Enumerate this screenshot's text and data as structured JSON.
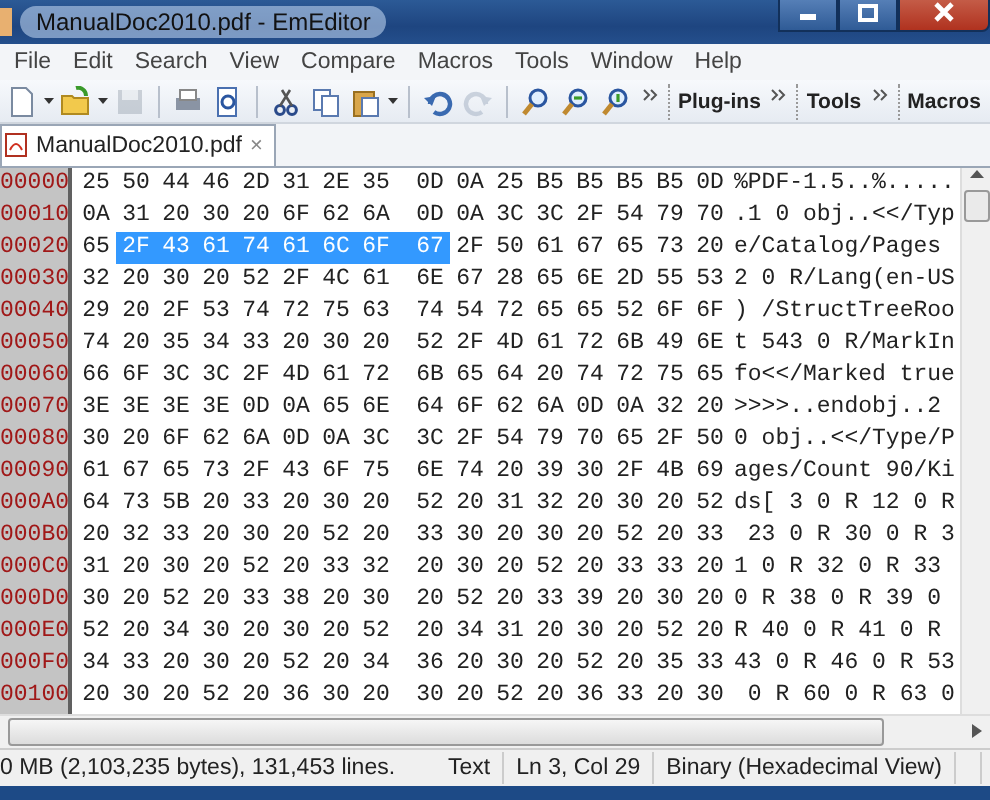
{
  "window": {
    "title": "ManualDoc2010.pdf - EmEditor"
  },
  "menu": [
    "File",
    "Edit",
    "Search",
    "View",
    "Compare",
    "Macros",
    "Tools",
    "Window",
    "Help"
  ],
  "toolbar": {
    "groups": [
      [
        {
          "kind": "new",
          "disabled": false
        },
        {
          "kind": "dropdown",
          "disabled": false
        },
        {
          "kind": "open",
          "disabled": false
        },
        {
          "kind": "dropdown",
          "disabled": false
        },
        {
          "kind": "save",
          "disabled": true
        }
      ],
      [
        {
          "kind": "print",
          "disabled": false
        },
        {
          "kind": "preview",
          "disabled": false
        }
      ],
      [
        {
          "kind": "cut",
          "disabled": false
        },
        {
          "kind": "copy",
          "disabled": false
        },
        {
          "kind": "paste",
          "disabled": false
        },
        {
          "kind": "dropdown",
          "disabled": false
        }
      ],
      [
        {
          "kind": "undo",
          "disabled": false
        },
        {
          "kind": "redo",
          "disabled": true
        }
      ],
      [
        {
          "kind": "find",
          "disabled": false
        },
        {
          "kind": "find-next",
          "disabled": false
        },
        {
          "kind": "find-prev",
          "disabled": false
        }
      ]
    ],
    "bands": [
      "Plug-ins",
      "Tools",
      "Macros"
    ]
  },
  "tabs": [
    {
      "label": "ManualDoc2010.pdf",
      "selected": true,
      "close": "×"
    }
  ],
  "hex_view": {
    "rows": [
      {
        "address": "00000",
        "bytes": [
          {
            "hex": "25",
            "selected": false
          },
          {
            "hex": "50",
            "selected": false
          },
          {
            "hex": "44",
            "selected": false
          },
          {
            "hex": "46",
            "selected": false
          },
          {
            "hex": "2D",
            "selected": false
          },
          {
            "hex": "31",
            "selected": false
          },
          {
            "hex": "2E",
            "selected": false
          },
          {
            "hex": "35",
            "selected": false
          },
          {
            "hex": "0D",
            "selected": false
          },
          {
            "hex": "0A",
            "selected": false
          },
          {
            "hex": "25",
            "selected": false
          },
          {
            "hex": "B5",
            "selected": false
          },
          {
            "hex": "B5",
            "selected": false
          },
          {
            "hex": "B5",
            "selected": false
          },
          {
            "hex": "B5",
            "selected": false
          },
          {
            "hex": "0D",
            "selected": false
          }
        ],
        "text": "%PDF-1.5..%....."
      },
      {
        "address": "00010",
        "bytes": [
          {
            "hex": "0A",
            "selected": false
          },
          {
            "hex": "31",
            "selected": false
          },
          {
            "hex": "20",
            "selected": false
          },
          {
            "hex": "30",
            "selected": false
          },
          {
            "hex": "20",
            "selected": false
          },
          {
            "hex": "6F",
            "selected": false
          },
          {
            "hex": "62",
            "selected": false
          },
          {
            "hex": "6A",
            "selected": false
          },
          {
            "hex": "0D",
            "selected": false
          },
          {
            "hex": "0A",
            "selected": false
          },
          {
            "hex": "3C",
            "selected": false
          },
          {
            "hex": "3C",
            "selected": false
          },
          {
            "hex": "2F",
            "selected": false
          },
          {
            "hex": "54",
            "selected": false
          },
          {
            "hex": "79",
            "selected": false
          },
          {
            "hex": "70",
            "selected": false
          }
        ],
        "text": ".1 0 obj..<</Typ"
      },
      {
        "address": "00020",
        "bytes": [
          {
            "hex": "65",
            "selected": false
          },
          {
            "hex": "2F",
            "selected": true
          },
          {
            "hex": "43",
            "selected": true
          },
          {
            "hex": "61",
            "selected": true
          },
          {
            "hex": "74",
            "selected": true
          },
          {
            "hex": "61",
            "selected": true
          },
          {
            "hex": "6C",
            "selected": true
          },
          {
            "hex": "6F",
            "selected": true
          },
          {
            "hex": "67",
            "selected": true
          },
          {
            "hex": "2F",
            "selected": false
          },
          {
            "hex": "50",
            "selected": false
          },
          {
            "hex": "61",
            "selected": false
          },
          {
            "hex": "67",
            "selected": false
          },
          {
            "hex": "65",
            "selected": false
          },
          {
            "hex": "73",
            "selected": false
          },
          {
            "hex": "20",
            "selected": false
          }
        ],
        "text": "e/Catalog/Pages"
      },
      {
        "address": "00030",
        "bytes": [
          {
            "hex": "32",
            "selected": false
          },
          {
            "hex": "20",
            "selected": false
          },
          {
            "hex": "30",
            "selected": false
          },
          {
            "hex": "20",
            "selected": false
          },
          {
            "hex": "52",
            "selected": false
          },
          {
            "hex": "2F",
            "selected": false
          },
          {
            "hex": "4C",
            "selected": false
          },
          {
            "hex": "61",
            "selected": false
          },
          {
            "hex": "6E",
            "selected": false
          },
          {
            "hex": "67",
            "selected": false
          },
          {
            "hex": "28",
            "selected": false
          },
          {
            "hex": "65",
            "selected": false
          },
          {
            "hex": "6E",
            "selected": false
          },
          {
            "hex": "2D",
            "selected": false
          },
          {
            "hex": "55",
            "selected": false
          },
          {
            "hex": "53",
            "selected": false
          }
        ],
        "text": "2 0 R/Lang(en-US"
      },
      {
        "address": "00040",
        "bytes": [
          {
            "hex": "29",
            "selected": false
          },
          {
            "hex": "20",
            "selected": false
          },
          {
            "hex": "2F",
            "selected": false
          },
          {
            "hex": "53",
            "selected": false
          },
          {
            "hex": "74",
            "selected": false
          },
          {
            "hex": "72",
            "selected": false
          },
          {
            "hex": "75",
            "selected": false
          },
          {
            "hex": "63",
            "selected": false
          },
          {
            "hex": "74",
            "selected": false
          },
          {
            "hex": "54",
            "selected": false
          },
          {
            "hex": "72",
            "selected": false
          },
          {
            "hex": "65",
            "selected": false
          },
          {
            "hex": "65",
            "selected": false
          },
          {
            "hex": "52",
            "selected": false
          },
          {
            "hex": "6F",
            "selected": false
          },
          {
            "hex": "6F",
            "selected": false
          }
        ],
        "text": ") /StructTreeRoo"
      },
      {
        "address": "00050",
        "bytes": [
          {
            "hex": "74",
            "selected": false
          },
          {
            "hex": "20",
            "selected": false
          },
          {
            "hex": "35",
            "selected": false
          },
          {
            "hex": "34",
            "selected": false
          },
          {
            "hex": "33",
            "selected": false
          },
          {
            "hex": "20",
            "selected": false
          },
          {
            "hex": "30",
            "selected": false
          },
          {
            "hex": "20",
            "selected": false
          },
          {
            "hex": "52",
            "selected": false
          },
          {
            "hex": "2F",
            "selected": false
          },
          {
            "hex": "4D",
            "selected": false
          },
          {
            "hex": "61",
            "selected": false
          },
          {
            "hex": "72",
            "selected": false
          },
          {
            "hex": "6B",
            "selected": false
          },
          {
            "hex": "49",
            "selected": false
          },
          {
            "hex": "6E",
            "selected": false
          }
        ],
        "text": "t 543 0 R/MarkIn"
      },
      {
        "address": "00060",
        "bytes": [
          {
            "hex": "66",
            "selected": false
          },
          {
            "hex": "6F",
            "selected": false
          },
          {
            "hex": "3C",
            "selected": false
          },
          {
            "hex": "3C",
            "selected": false
          },
          {
            "hex": "2F",
            "selected": false
          },
          {
            "hex": "4D",
            "selected": false
          },
          {
            "hex": "61",
            "selected": false
          },
          {
            "hex": "72",
            "selected": false
          },
          {
            "hex": "6B",
            "selected": false
          },
          {
            "hex": "65",
            "selected": false
          },
          {
            "hex": "64",
            "selected": false
          },
          {
            "hex": "20",
            "selected": false
          },
          {
            "hex": "74",
            "selected": false
          },
          {
            "hex": "72",
            "selected": false
          },
          {
            "hex": "75",
            "selected": false
          },
          {
            "hex": "65",
            "selected": false
          }
        ],
        "text": "fo<</Marked true"
      },
      {
        "address": "00070",
        "bytes": [
          {
            "hex": "3E",
            "selected": false
          },
          {
            "hex": "3E",
            "selected": false
          },
          {
            "hex": "3E",
            "selected": false
          },
          {
            "hex": "3E",
            "selected": false
          },
          {
            "hex": "0D",
            "selected": false
          },
          {
            "hex": "0A",
            "selected": false
          },
          {
            "hex": "65",
            "selected": false
          },
          {
            "hex": "6E",
            "selected": false
          },
          {
            "hex": "64",
            "selected": false
          },
          {
            "hex": "6F",
            "selected": false
          },
          {
            "hex": "62",
            "selected": false
          },
          {
            "hex": "6A",
            "selected": false
          },
          {
            "hex": "0D",
            "selected": false
          },
          {
            "hex": "0A",
            "selected": false
          },
          {
            "hex": "32",
            "selected": false
          },
          {
            "hex": "20",
            "selected": false
          }
        ],
        "text": ">>>>..endobj..2"
      },
      {
        "address": "00080",
        "bytes": [
          {
            "hex": "30",
            "selected": false
          },
          {
            "hex": "20",
            "selected": false
          },
          {
            "hex": "6F",
            "selected": false
          },
          {
            "hex": "62",
            "selected": false
          },
          {
            "hex": "6A",
            "selected": false
          },
          {
            "hex": "0D",
            "selected": false
          },
          {
            "hex": "0A",
            "selected": false
          },
          {
            "hex": "3C",
            "selected": false
          },
          {
            "hex": "3C",
            "selected": false
          },
          {
            "hex": "2F",
            "selected": false
          },
          {
            "hex": "54",
            "selected": false
          },
          {
            "hex": "79",
            "selected": false
          },
          {
            "hex": "70",
            "selected": false
          },
          {
            "hex": "65",
            "selected": false
          },
          {
            "hex": "2F",
            "selected": false
          },
          {
            "hex": "50",
            "selected": false
          }
        ],
        "text": "0 obj..<</Type/P"
      },
      {
        "address": "00090",
        "bytes": [
          {
            "hex": "61",
            "selected": false
          },
          {
            "hex": "67",
            "selected": false
          },
          {
            "hex": "65",
            "selected": false
          },
          {
            "hex": "73",
            "selected": false
          },
          {
            "hex": "2F",
            "selected": false
          },
          {
            "hex": "43",
            "selected": false
          },
          {
            "hex": "6F",
            "selected": false
          },
          {
            "hex": "75",
            "selected": false
          },
          {
            "hex": "6E",
            "selected": false
          },
          {
            "hex": "74",
            "selected": false
          },
          {
            "hex": "20",
            "selected": false
          },
          {
            "hex": "39",
            "selected": false
          },
          {
            "hex": "30",
            "selected": false
          },
          {
            "hex": "2F",
            "selected": false
          },
          {
            "hex": "4B",
            "selected": false
          },
          {
            "hex": "69",
            "selected": false
          }
        ],
        "text": "ages/Count 90/Ki"
      },
      {
        "address": "000A0",
        "bytes": [
          {
            "hex": "64",
            "selected": false
          },
          {
            "hex": "73",
            "selected": false
          },
          {
            "hex": "5B",
            "selected": false
          },
          {
            "hex": "20",
            "selected": false
          },
          {
            "hex": "33",
            "selected": false
          },
          {
            "hex": "20",
            "selected": false
          },
          {
            "hex": "30",
            "selected": false
          },
          {
            "hex": "20",
            "selected": false
          },
          {
            "hex": "52",
            "selected": false
          },
          {
            "hex": "20",
            "selected": false
          },
          {
            "hex": "31",
            "selected": false
          },
          {
            "hex": "32",
            "selected": false
          },
          {
            "hex": "20",
            "selected": false
          },
          {
            "hex": "30",
            "selected": false
          },
          {
            "hex": "20",
            "selected": false
          },
          {
            "hex": "52",
            "selected": false
          }
        ],
        "text": "ds[ 3 0 R 12 0 R"
      },
      {
        "address": "000B0",
        "bytes": [
          {
            "hex": "20",
            "selected": false
          },
          {
            "hex": "32",
            "selected": false
          },
          {
            "hex": "33",
            "selected": false
          },
          {
            "hex": "20",
            "selected": false
          },
          {
            "hex": "30",
            "selected": false
          },
          {
            "hex": "20",
            "selected": false
          },
          {
            "hex": "52",
            "selected": false
          },
          {
            "hex": "20",
            "selected": false
          },
          {
            "hex": "33",
            "selected": false
          },
          {
            "hex": "30",
            "selected": false
          },
          {
            "hex": "20",
            "selected": false
          },
          {
            "hex": "30",
            "selected": false
          },
          {
            "hex": "20",
            "selected": false
          },
          {
            "hex": "52",
            "selected": false
          },
          {
            "hex": "20",
            "selected": false
          },
          {
            "hex": "33",
            "selected": false
          }
        ],
        "text": " 23 0 R 30 0 R 3"
      },
      {
        "address": "000C0",
        "bytes": [
          {
            "hex": "31",
            "selected": false
          },
          {
            "hex": "20",
            "selected": false
          },
          {
            "hex": "30",
            "selected": false
          },
          {
            "hex": "20",
            "selected": false
          },
          {
            "hex": "52",
            "selected": false
          },
          {
            "hex": "20",
            "selected": false
          },
          {
            "hex": "33",
            "selected": false
          },
          {
            "hex": "32",
            "selected": false
          },
          {
            "hex": "20",
            "selected": false
          },
          {
            "hex": "30",
            "selected": false
          },
          {
            "hex": "20",
            "selected": false
          },
          {
            "hex": "52",
            "selected": false
          },
          {
            "hex": "20",
            "selected": false
          },
          {
            "hex": "33",
            "selected": false
          },
          {
            "hex": "33",
            "selected": false
          },
          {
            "hex": "20",
            "selected": false
          }
        ],
        "text": "1 0 R 32 0 R 33"
      },
      {
        "address": "000D0",
        "bytes": [
          {
            "hex": "30",
            "selected": false
          },
          {
            "hex": "20",
            "selected": false
          },
          {
            "hex": "52",
            "selected": false
          },
          {
            "hex": "20",
            "selected": false
          },
          {
            "hex": "33",
            "selected": false
          },
          {
            "hex": "38",
            "selected": false
          },
          {
            "hex": "20",
            "selected": false
          },
          {
            "hex": "30",
            "selected": false
          },
          {
            "hex": "20",
            "selected": false
          },
          {
            "hex": "52",
            "selected": false
          },
          {
            "hex": "20",
            "selected": false
          },
          {
            "hex": "33",
            "selected": false
          },
          {
            "hex": "39",
            "selected": false
          },
          {
            "hex": "20",
            "selected": false
          },
          {
            "hex": "30",
            "selected": false
          },
          {
            "hex": "20",
            "selected": false
          }
        ],
        "text": "0 R 38 0 R 39 0"
      },
      {
        "address": "000E0",
        "bytes": [
          {
            "hex": "52",
            "selected": false
          },
          {
            "hex": "20",
            "selected": false
          },
          {
            "hex": "34",
            "selected": false
          },
          {
            "hex": "30",
            "selected": false
          },
          {
            "hex": "20",
            "selected": false
          },
          {
            "hex": "30",
            "selected": false
          },
          {
            "hex": "20",
            "selected": false
          },
          {
            "hex": "52",
            "selected": false
          },
          {
            "hex": "20",
            "selected": false
          },
          {
            "hex": "34",
            "selected": false
          },
          {
            "hex": "31",
            "selected": false
          },
          {
            "hex": "20",
            "selected": false
          },
          {
            "hex": "30",
            "selected": false
          },
          {
            "hex": "20",
            "selected": false
          },
          {
            "hex": "52",
            "selected": false
          },
          {
            "hex": "20",
            "selected": false
          }
        ],
        "text": "R 40 0 R 41 0 R"
      },
      {
        "address": "000F0",
        "bytes": [
          {
            "hex": "34",
            "selected": false
          },
          {
            "hex": "33",
            "selected": false
          },
          {
            "hex": "20",
            "selected": false
          },
          {
            "hex": "30",
            "selected": false
          },
          {
            "hex": "20",
            "selected": false
          },
          {
            "hex": "52",
            "selected": false
          },
          {
            "hex": "20",
            "selected": false
          },
          {
            "hex": "34",
            "selected": false
          },
          {
            "hex": "36",
            "selected": false
          },
          {
            "hex": "20",
            "selected": false
          },
          {
            "hex": "30",
            "selected": false
          },
          {
            "hex": "20",
            "selected": false
          },
          {
            "hex": "52",
            "selected": false
          },
          {
            "hex": "20",
            "selected": false
          },
          {
            "hex": "35",
            "selected": false
          },
          {
            "hex": "33",
            "selected": false
          }
        ],
        "text": "43 0 R 46 0 R 53"
      },
      {
        "address": "00100",
        "bytes": [
          {
            "hex": "20",
            "selected": false
          },
          {
            "hex": "30",
            "selected": false
          },
          {
            "hex": "20",
            "selected": false
          },
          {
            "hex": "52",
            "selected": false
          },
          {
            "hex": "20",
            "selected": false
          },
          {
            "hex": "36",
            "selected": false
          },
          {
            "hex": "30",
            "selected": false
          },
          {
            "hex": "20",
            "selected": false
          },
          {
            "hex": "30",
            "selected": false
          },
          {
            "hex": "20",
            "selected": false
          },
          {
            "hex": "52",
            "selected": false
          },
          {
            "hex": "20",
            "selected": false
          },
          {
            "hex": "36",
            "selected": false
          },
          {
            "hex": "33",
            "selected": false
          },
          {
            "hex": "20",
            "selected": false
          },
          {
            "hex": "30",
            "selected": false
          }
        ],
        "text": " 0 R 60 0 R 63 0"
      }
    ]
  },
  "status_bar": {
    "file_info": "0 MB (2,103,235 bytes), 131,453 lines.",
    "mode": "Text",
    "position": "Ln 3, Col 29",
    "view": "Binary (Hexadecimal View)"
  }
}
